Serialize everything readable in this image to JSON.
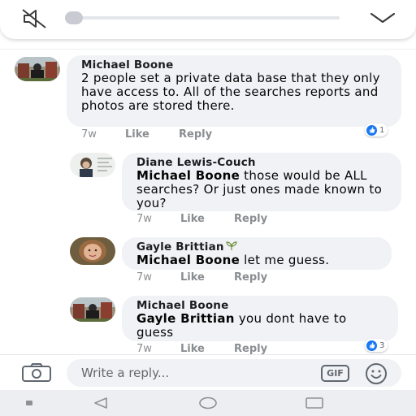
{
  "colors": {
    "accent": "#1877f2",
    "bubble": "#f0f2f5",
    "meta_text": "#8a8d91",
    "navbar": "#eceef1"
  },
  "media_bar": {
    "icons": [
      "mute-icon",
      "chevron-down-icon"
    ],
    "progress": 0.02
  },
  "comments": [
    {
      "author": "Michael Boone",
      "text": "2 people set a private data base that they only have access to.  All of the searches reports and photos  are stored there.",
      "time": "7w",
      "like_label": "Like",
      "reply_label": "Reply",
      "reaction_count": "1"
    },
    {
      "author": "Diane Lewis-Couch",
      "mention": "Michael Boone",
      "text": " those would be ALL searches? Or just ones made known to you?",
      "time": "7w",
      "like_label": "Like",
      "reply_label": "Reply"
    },
    {
      "author": "Gayle Brittian",
      "mention": "Michael Boone",
      "text": " let me guess.",
      "time": "7w",
      "like_label": "Like",
      "reply_label": "Reply"
    },
    {
      "author": "Michael Boone",
      "mention": "Gayle Brittian",
      "text": " you dont have to guess",
      "time": "7w",
      "like_label": "Like",
      "reply_label": "Reply",
      "reaction_count": "3"
    }
  ],
  "composer": {
    "placeholder": "Write a reply...",
    "gif_label": "GIF",
    "icons": [
      "camera-icon",
      "emoji-icon"
    ]
  },
  "navbar": {
    "icons": [
      "back-icon",
      "home-icon",
      "recents-icon"
    ]
  }
}
